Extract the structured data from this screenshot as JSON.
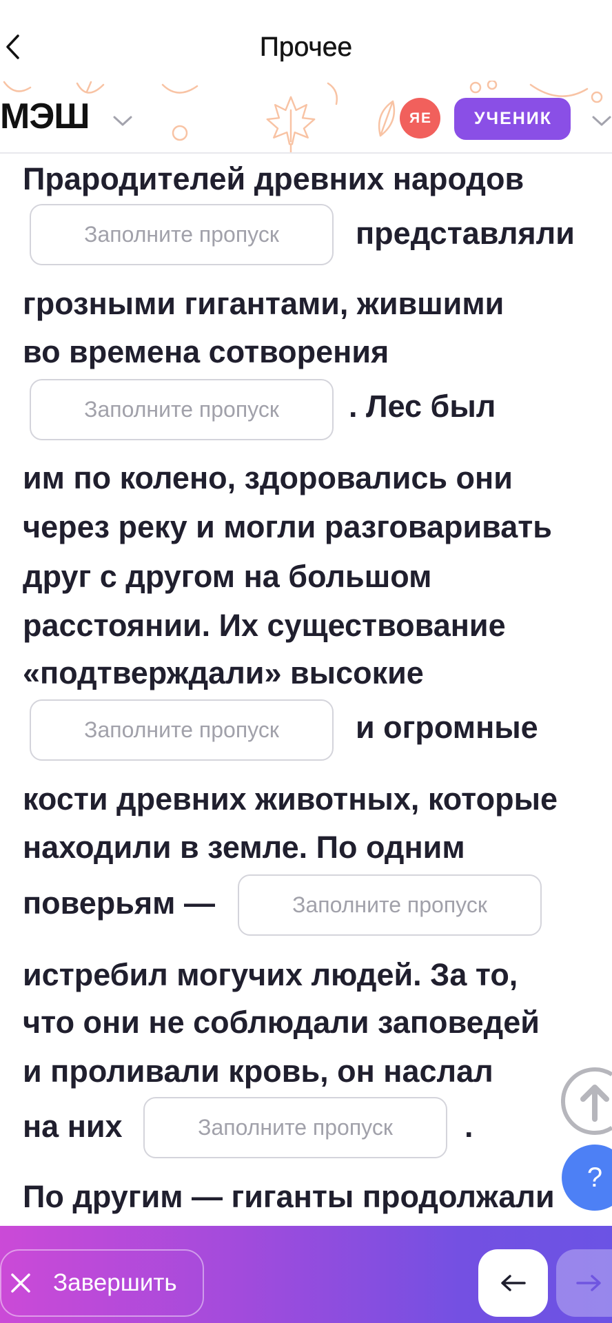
{
  "nav": {
    "back_icon": "chevron-left-icon",
    "title": "Прочее"
  },
  "header": {
    "logo": "МЭШ",
    "logo_menu_icon": "chevron-down-icon",
    "avatar_initials": "ЯЕ",
    "role": "УЧЕНИК",
    "role_menu_icon": "chevron-down-icon",
    "decoration_icon": "maple-leaf-icon"
  },
  "exercise": {
    "lines": [
      {
        "text": "Прародителей древних народов"
      },
      {
        "blank": {
          "value": "",
          "placeholder": "Заполните пропуск"
        },
        "after": "представляли"
      },
      {
        "text": "грозными гигантами, жившими"
      },
      {
        "text": "во времена сотворения"
      },
      {
        "blank": {
          "value": "",
          "placeholder": "Заполните пропуск"
        },
        "after": ". Лес был"
      },
      {
        "text": "им по колено, здоровались они"
      },
      {
        "text": "через реку и могли разговаривать"
      },
      {
        "text": "друг с другом на большом"
      },
      {
        "text": "расстоянии. Их существование"
      },
      {
        "text": "«подтверждали» высокие"
      },
      {
        "blank": {
          "value": "",
          "placeholder": "Заполните пропуск"
        },
        "after": "и огромные"
      },
      {
        "text": "кости древних животных, которые"
      },
      {
        "text": "находили в земле. По одним"
      },
      {
        "before": "поверьям —",
        "blank": {
          "value": "",
          "placeholder": "Заполните пропуск"
        }
      },
      {
        "text": "истребил могучих людей. За то,"
      },
      {
        "text": "что они не соблюдали заповедей"
      },
      {
        "text": "и проливали кровь, он наслал"
      },
      {
        "before": "на них",
        "blank": {
          "value": "",
          "placeholder": "Заполните пропуск"
        },
        "after": "."
      },
      {
        "text": "По другим — гиганты продолжали"
      }
    ]
  },
  "floating": {
    "scroll_top_icon": "arrow-up-icon",
    "help_label": "?"
  },
  "footer": {
    "finish_icon": "close-icon",
    "finish_label": "Завершить",
    "prev_icon": "arrow-left-icon",
    "next_icon": "arrow-right-icon"
  },
  "colors": {
    "text": "#201f2e",
    "placeholder": "#a1a1aa",
    "border": "#d4d4db",
    "badge": "#8a4fe6",
    "avatar": "#f1605c",
    "help": "#4d80f5",
    "bar_start": "#cb4ad7",
    "bar_end": "#6b53e4",
    "decor": "#f8c3a4"
  }
}
